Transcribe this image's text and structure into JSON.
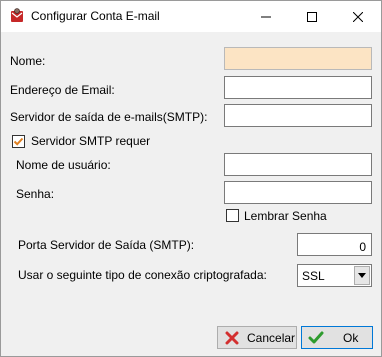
{
  "window": {
    "title": "Configurar Conta E-mail"
  },
  "form": {
    "nome_label": "Nome:",
    "nome_value": "",
    "email_label": "Endereço de Email:",
    "email_value": "",
    "smtp_label": "Servidor de saída de e-mails(SMTP):",
    "smtp_value": "",
    "smtp_auth_label": "Servidor SMTP requer",
    "smtp_auth_checked": true,
    "usuario_label": "Nome de usuário:",
    "usuario_value": "",
    "senha_label": "Senha:",
    "senha_value": "",
    "lembrar_label": "Lembrar Senha",
    "lembrar_checked": false,
    "porta_label": "Porta Servidor de Saída (SMTP):",
    "porta_value": "0",
    "cripto_label": "Usar o seguinte tipo de conexão criptografada:",
    "cripto_value": "SSL"
  },
  "buttons": {
    "cancel_label": "Cancelar",
    "ok_label": "Ok"
  },
  "icons": {
    "app": "gear-envelope-icon",
    "cancel": "red-x-icon",
    "ok": "green-check-icon"
  },
  "colors": {
    "focused_field": "#fce4c4",
    "cancel_icon": "#d32f2f",
    "ok_icon": "#2e9b2e"
  }
}
